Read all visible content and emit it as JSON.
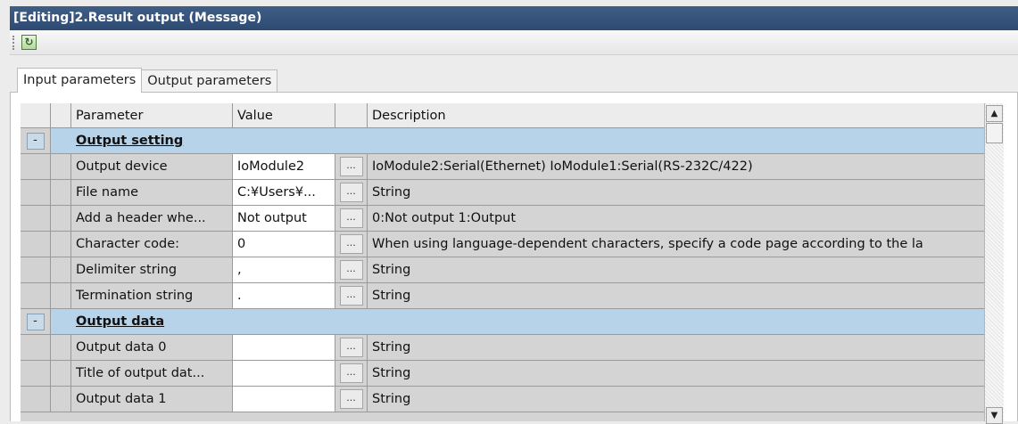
{
  "window": {
    "title": "[Editing]2.Result output (Message)"
  },
  "toolbar": {
    "refresh_icon": "refresh-icon"
  },
  "tabs": [
    {
      "label": "Input parameters",
      "active": true
    },
    {
      "label": "Output parameters",
      "active": false
    }
  ],
  "grid": {
    "columns": {
      "parameter": "Parameter",
      "value": "Value",
      "description": "Description"
    },
    "browse_label": "...",
    "groups": [
      {
        "toggle": "-",
        "title": "Output setting",
        "rows": [
          {
            "parameter": "Output device",
            "value": "IoModule2",
            "description": "IoModule2:Serial(Ethernet) IoModule1:Serial(RS-232C/422)"
          },
          {
            "parameter": "File name",
            "value": "C:¥Users¥...",
            "description": "String"
          },
          {
            "parameter": "Add a header whe...",
            "value": "Not output",
            "description": "0:Not output 1:Output"
          },
          {
            "parameter": "Character code:",
            "value": "0",
            "description": "When using language-dependent characters, specify a code page according to the la"
          },
          {
            "parameter": "Delimiter string",
            "value": ",",
            "description": "String"
          },
          {
            "parameter": "Termination string",
            "value": ".",
            "description": "String"
          }
        ]
      },
      {
        "toggle": "-",
        "title": "Output data",
        "rows": [
          {
            "parameter": "Output data 0",
            "value": "",
            "description": "String"
          },
          {
            "parameter": "Title of output dat...",
            "value": "",
            "description": "String"
          },
          {
            "parameter": "Output data 1",
            "value": "",
            "description": "String"
          }
        ]
      }
    ]
  },
  "scrollbar": {
    "up_icon": "scroll-up-icon",
    "down_icon": "scroll-down-icon"
  }
}
